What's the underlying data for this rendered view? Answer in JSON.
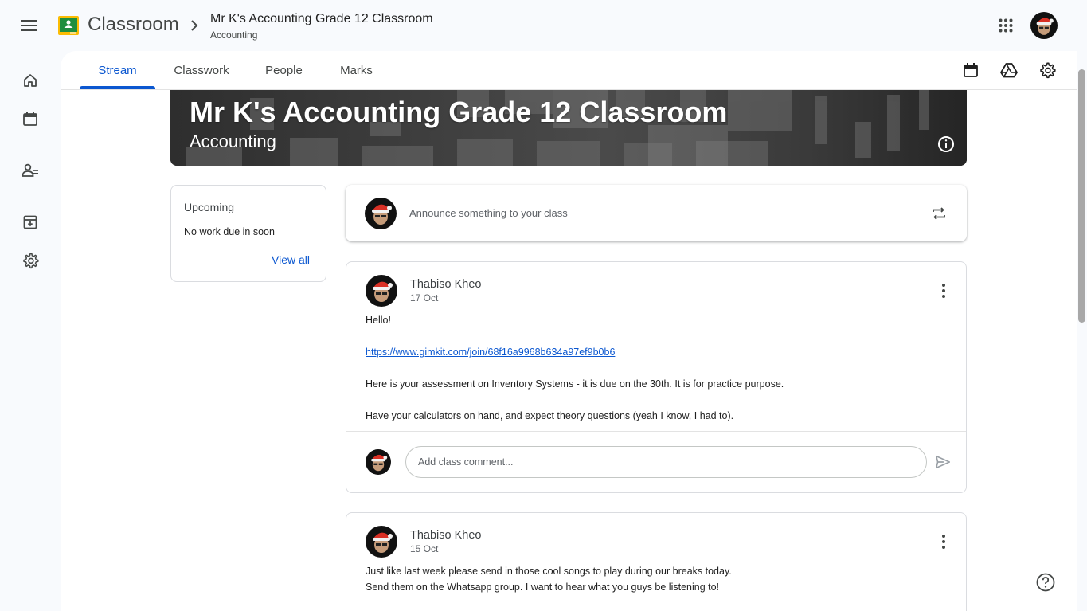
{
  "header": {
    "app_name": "Classroom",
    "class_title": "Mr K's Accounting Grade 12 Classroom",
    "class_subtitle": "Accounting"
  },
  "tabs": [
    {
      "label": "Stream",
      "active": true
    },
    {
      "label": "Classwork",
      "active": false
    },
    {
      "label": "People",
      "active": false
    },
    {
      "label": "Marks",
      "active": false
    }
  ],
  "banner": {
    "title": "Mr K's Accounting Grade 12 Classroom",
    "subtitle": "Accounting"
  },
  "upcoming": {
    "title": "Upcoming",
    "text": "No work due in soon",
    "link": "View all"
  },
  "announce": {
    "placeholder": "Announce something to your class"
  },
  "posts": [
    {
      "author": "Thabiso Kheo",
      "date": "17 Oct",
      "lines": [
        "Hello!",
        "",
        "https://www.gimkit.com/join/68f16a9968b634a97ef9b0b6",
        "",
        "Here is your assessment on Inventory Systems - it is due on the 30th. It is for practice purpose.",
        "",
        "Have your calculators on hand, and expect theory questions (yeah I know, I had to)."
      ],
      "comment_placeholder": "Add class comment..."
    },
    {
      "author": "Thabiso Kheo",
      "date": "15 Oct",
      "lines": [
        "Just like last week please send in those cool songs to play during our breaks today.",
        "Send them on the Whatsapp group. I want to hear what you guys be listening to!"
      ]
    }
  ],
  "colors": {
    "accent": "#0b57d0",
    "background": "#f8fafd",
    "logo_green": "#1e8e3e",
    "logo_yellow": "#fbbc04"
  },
  "icons": [
    "menu-icon",
    "classroom-logo-icon",
    "chevron-right-icon",
    "apps-grid-icon",
    "home-icon",
    "calendar-icon",
    "people-icon",
    "archive-icon",
    "settings-icon",
    "drive-icon",
    "info-icon",
    "repost-icon",
    "more-vert-icon",
    "send-icon",
    "help-icon"
  ]
}
